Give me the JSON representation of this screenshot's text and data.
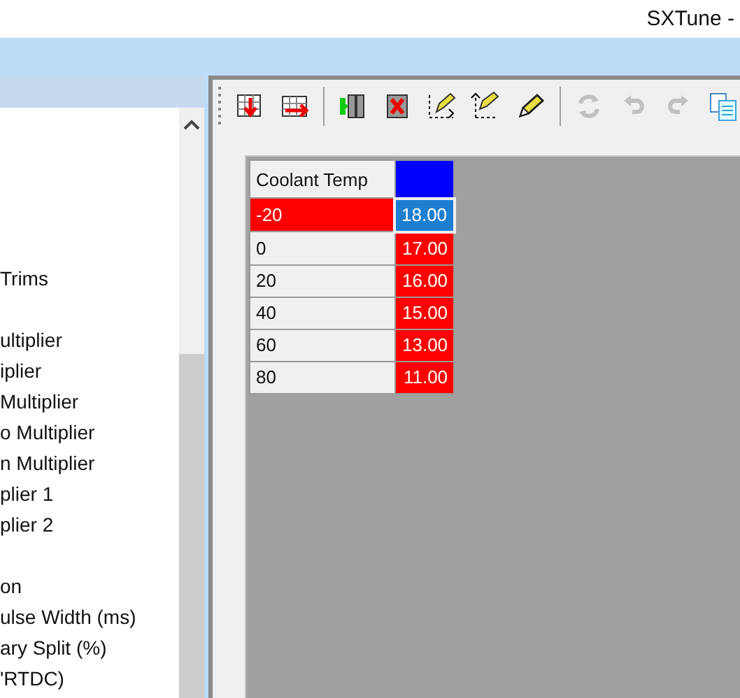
{
  "window": {
    "title": "SXTune -"
  },
  "tree": {
    "groups": [
      {
        "items": [
          "Trims"
        ]
      },
      {
        "items": [
          "ultiplier",
          "iplier",
          "Multiplier",
          "o Multiplier",
          "n Multiplier",
          "plier 1",
          "plier 2"
        ]
      },
      {
        "items": [
          "on",
          "ulse Width (ms)",
          "ary Split (%)",
          "'RTDC)"
        ]
      }
    ]
  },
  "toolbar": [
    {
      "kind": "insert-row",
      "disabled": false
    },
    {
      "kind": "insert-column",
      "disabled": false
    },
    {
      "kind": "separator"
    },
    {
      "kind": "add-column",
      "disabled": false
    },
    {
      "kind": "delete-column",
      "disabled": false
    },
    {
      "kind": "edit-x",
      "disabled": false
    },
    {
      "kind": "edit-y",
      "disabled": false
    },
    {
      "kind": "pencil",
      "disabled": false
    },
    {
      "kind": "separator"
    },
    {
      "kind": "refresh",
      "disabled": true
    },
    {
      "kind": "undo",
      "disabled": true
    },
    {
      "kind": "redo",
      "disabled": true
    },
    {
      "kind": "copy",
      "disabled": false
    }
  ],
  "table": {
    "header": "Coolant Temp",
    "rows": [
      {
        "label": "-20",
        "value": "18.00",
        "selected": true
      },
      {
        "label": "0",
        "value": "17.00",
        "selected": false
      },
      {
        "label": "20",
        "value": "16.00",
        "selected": false
      },
      {
        "label": "40",
        "value": "15.00",
        "selected": false
      },
      {
        "label": "60",
        "value": "13.00",
        "selected": false
      },
      {
        "label": "80",
        "value": "11.00",
        "selected": false
      }
    ]
  }
}
